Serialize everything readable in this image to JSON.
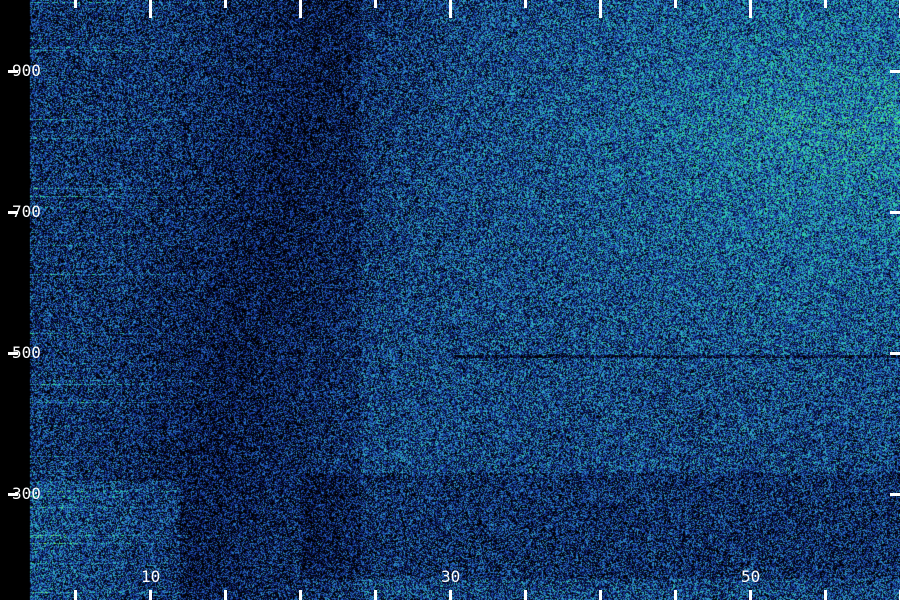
{
  "chart_data": {
    "type": "heatmap",
    "title": "",
    "xlabel": "",
    "ylabel": "",
    "x_ticks": [
      10,
      30,
      50
    ],
    "x_ticks_minor": [
      5,
      10,
      15,
      20,
      25,
      30,
      35,
      40,
      45,
      50,
      55,
      60
    ],
    "y_ticks": [
      300,
      500,
      700,
      900
    ],
    "xlim": [
      2,
      60
    ],
    "ylim": [
      150,
      1000
    ],
    "colormap": [
      "#000000",
      "#0a1550",
      "#1838a0",
      "#2a78c8",
      "#35b4c0",
      "#22e0a0",
      "#90ff40"
    ],
    "label_color": "#ffffff",
    "description_regions": {
      "dark_band_x": [
        5,
        25
      ],
      "bright_region_x": [
        30,
        60
      ],
      "bright_region_y": [
        650,
        950
      ],
      "dark_horizontal_line_y": 495
    }
  }
}
